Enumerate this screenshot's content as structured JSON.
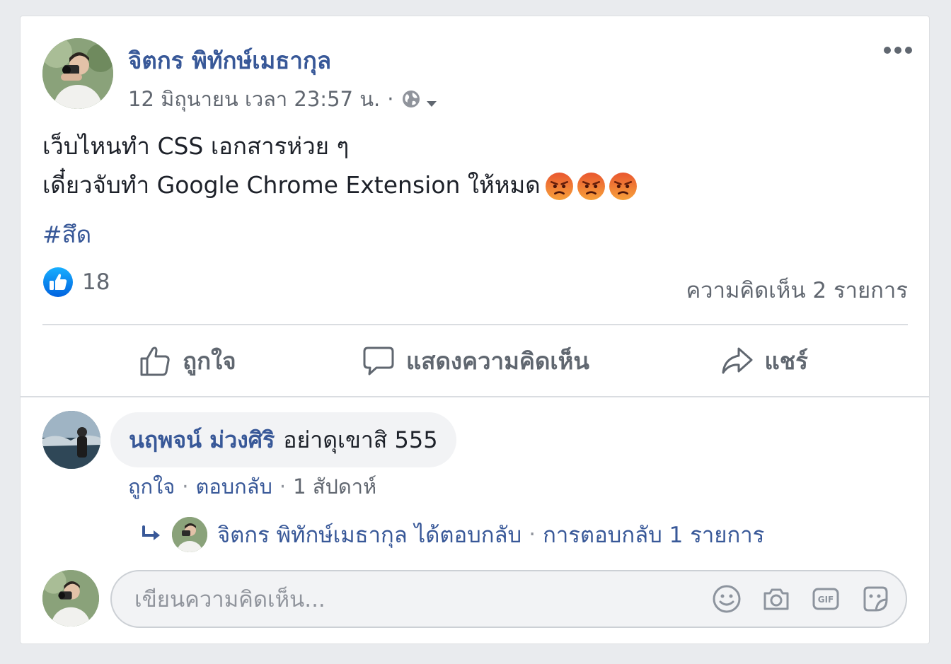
{
  "post": {
    "author_name": "จิตกร พิทักษ์เมธากุล",
    "timestamp": "12 มิถุนายน เวลา 23:57 น.",
    "meta_separator": "·",
    "privacy_icon": "globe-icon",
    "text_line1": "เว็บไหนทำ CSS เอกสารห่วย ๆ",
    "text_line2": "เดี๋ยวจับทำ Google Chrome Extension ให้หมด",
    "emojis": [
      "angry-emoji",
      "angry-emoji",
      "angry-emoji"
    ],
    "hashtag": "#สึด",
    "reaction_count": "18",
    "comment_count_label": "ความคิดเห็น 2 รายการ"
  },
  "actions": {
    "like_label": "ถูกใจ",
    "comment_label": "แสดงความคิดเห็น",
    "share_label": "แชร์"
  },
  "comment": {
    "author_name": "นฤพจน์ ม่วงศิริ",
    "text": "อย่าดุเขาสิ 555",
    "like_label": "ถูกใจ",
    "reply_label": "ตอบกลับ",
    "time_label": "1 สัปดาห์",
    "separator": "·"
  },
  "reply_summary": {
    "author_name": "จิตกร พิทักษ์เมธากุล",
    "action_text": "ได้ตอบกลับ",
    "separator": "·",
    "count_text": "การตอบกลับ 1 รายการ"
  },
  "composer": {
    "placeholder": "เขียนความคิดเห็น...",
    "icons": [
      "emoji-icon",
      "camera-icon",
      "gif-icon",
      "sticker-icon"
    ]
  },
  "colors": {
    "link_blue": "#385898",
    "like_blue": "#2078f4",
    "muted": "#616770",
    "angry_orange": "#f0622d"
  }
}
